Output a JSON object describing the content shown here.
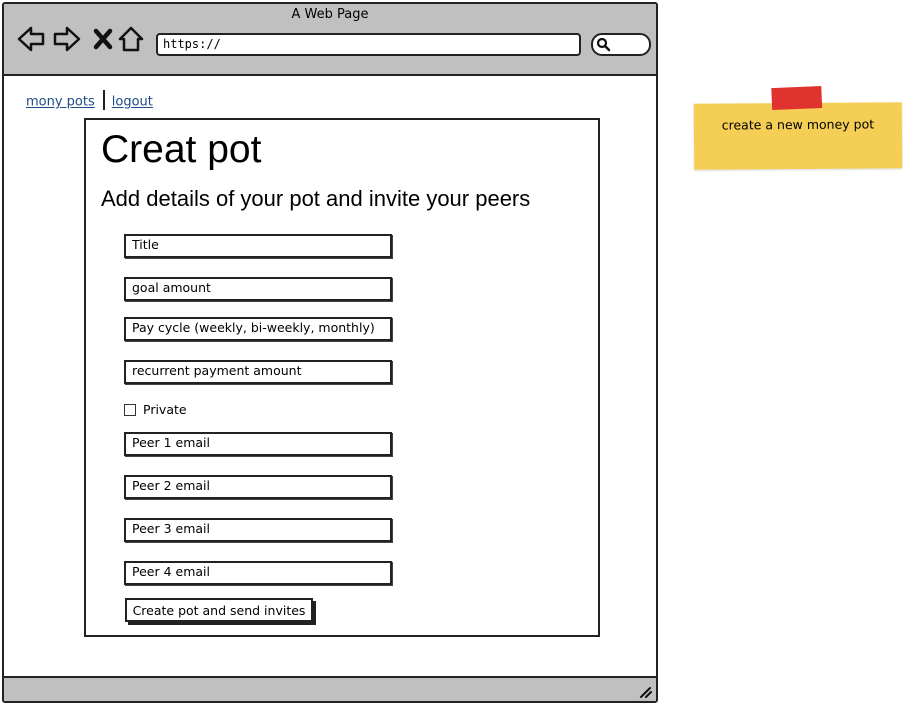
{
  "window": {
    "title": "A Web Page",
    "url": "https://"
  },
  "nav_links": {
    "home": "mony pots",
    "logout": "logout"
  },
  "form": {
    "title": "Creat pot",
    "subtitle": "Add details of your pot and invite your peers",
    "fields": {
      "title": "Title",
      "goal_amount": "goal amount",
      "pay_cycle": "Pay cycle (weekly, bi-weekly, monthly)",
      "recurrent_amount": "recurrent payment amount",
      "peer1": "Peer 1 email",
      "peer2": "Peer 2 email",
      "peer3": "Peer 3 email",
      "peer4": "Peer 4 email"
    },
    "private_label": "Private",
    "private_checked": false,
    "submit_label": "Create pot and send invites"
  },
  "note": {
    "text": "create a new money pot",
    "color": "#f5cf55",
    "tape_color": "#e0322e"
  },
  "icons": [
    "back-icon",
    "forward-icon",
    "close-icon",
    "home-icon",
    "search-icon",
    "resize-grip-icon"
  ]
}
